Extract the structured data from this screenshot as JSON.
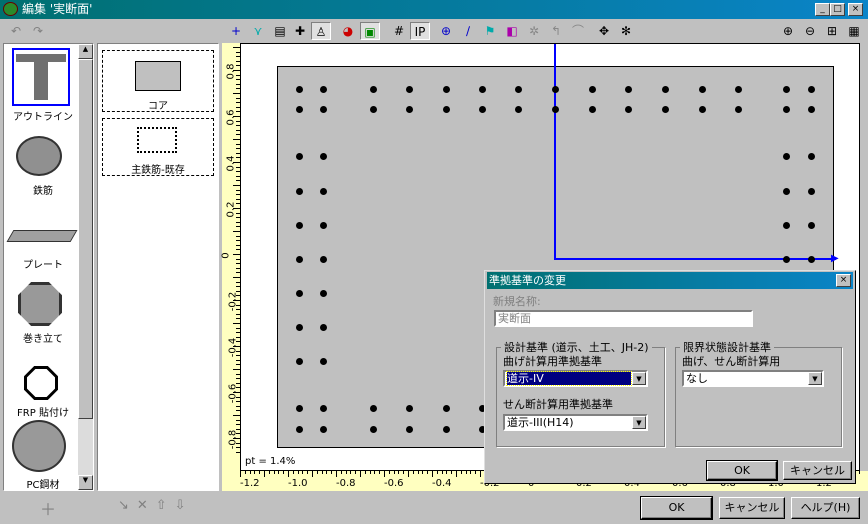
{
  "window": {
    "title": "編集 '実断面'",
    "min": "_",
    "max": "□",
    "close": "×"
  },
  "toolbar": {
    "undo": "↶",
    "redo": "↷"
  },
  "palette": {
    "items": [
      {
        "label": "アウトライン"
      },
      {
        "label": "鉄筋"
      },
      {
        "label": "プレート"
      },
      {
        "label": "巻き立て"
      },
      {
        "label": "FRP 貼付け"
      },
      {
        "label": "PC鋼材"
      }
    ]
  },
  "templates": {
    "items": [
      {
        "label": "コア"
      },
      {
        "label": "主鉄筋-既存"
      }
    ]
  },
  "canvas": {
    "status": "pt = 1.4%",
    "x_ticks": [
      "-1.2",
      "-1.0",
      "-0.8",
      "-0.6",
      "-0.4",
      "-0.2",
      "0",
      "0.2",
      "0.4",
      "0.6",
      "0.8",
      "1.0",
      "1.2"
    ],
    "y_ticks": [
      "0.8",
      "0.6",
      "0.4",
      "0.2",
      "0",
      "-0.2",
      "-0.4",
      "-0.6",
      "-0.8"
    ]
  },
  "bottom": {
    "ok": "OK",
    "cancel": "キャンセル",
    "help": "ヘルプ(H)"
  },
  "dialog": {
    "title": "準拠基準の変更",
    "close": "×",
    "name_label": "新規名称:",
    "name_value": "実断面",
    "group1": {
      "legend": "設計基準 (道示、土工、JH-2)",
      "bend_label": "曲げ計算用準拠基準",
      "bend_value": "道示-IV",
      "shear_label": "せん断計算用準拠基準",
      "shear_value": "道示-III(H14)"
    },
    "group2": {
      "legend": "限界状態設計基準",
      "label": "曲げ、せん断計算用",
      "value": "なし"
    },
    "ok": "OK",
    "cancel": "キャンセル"
  },
  "colors": {
    "title_start": "#007070",
    "title_end": "#0a84c8",
    "axis": "#0000ff",
    "section": "#c0c0c0",
    "ruler": "#ffffc0"
  }
}
